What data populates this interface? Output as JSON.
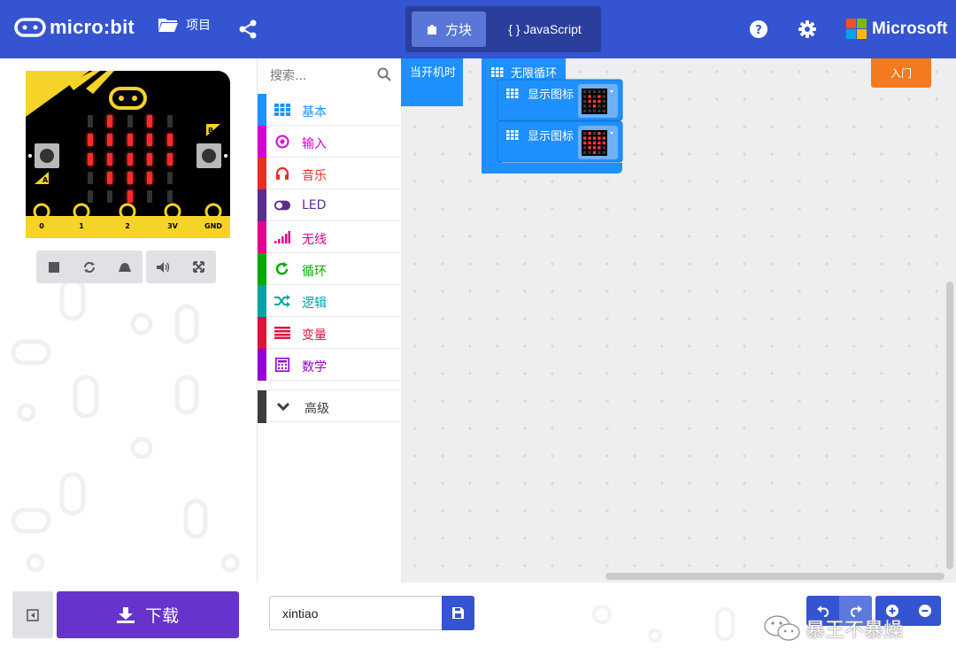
{
  "header": {
    "logo_text": "micro:bit",
    "projects_label": "项目",
    "share_icon": "share-icon",
    "mode_blocks_label": "方块",
    "mode_js_label": "{ } JavaScript",
    "help_icon": "help-icon",
    "settings_icon": "gear-icon",
    "brand_text": "Microsoft"
  },
  "simulator": {
    "led_matrix_on": [
      [
        0,
        1,
        0,
        1,
        0
      ],
      [
        1,
        1,
        1,
        1,
        1
      ],
      [
        1,
        1,
        1,
        1,
        1
      ],
      [
        0,
        1,
        1,
        1,
        0
      ],
      [
        0,
        0,
        1,
        0,
        0
      ]
    ],
    "pins": [
      "0",
      "1",
      "2",
      "3V",
      "GND"
    ],
    "button_a": "A",
    "button_b": "B",
    "controls": [
      "stop-icon",
      "restart-icon",
      "slow-mo-icon",
      "mute-icon",
      "fullscreen-icon"
    ]
  },
  "toolbox": {
    "search_placeholder": "搜索...",
    "categories": [
      {
        "label": "基本",
        "color": "#1e90ff",
        "icon": "grid-icon"
      },
      {
        "label": "输入",
        "color": "#d400d4",
        "icon": "target-icon"
      },
      {
        "label": "音乐",
        "color": "#e63022",
        "icon": "headphones-icon"
      },
      {
        "label": "LED",
        "color": "#5c2d91",
        "icon": "toggle-icon"
      },
      {
        "label": "无线",
        "color": "#e3008c",
        "icon": "signal-icon"
      },
      {
        "label": "循环",
        "color": "#00aa00",
        "icon": "loop-icon"
      },
      {
        "label": "逻辑",
        "color": "#00a4a6",
        "icon": "shuffle-icon"
      },
      {
        "label": "变量",
        "color": "#dc143c",
        "icon": "lines-icon"
      },
      {
        "label": "数学",
        "color": "#9400d3",
        "icon": "calculator-icon"
      }
    ],
    "advanced_label": "高级"
  },
  "workspace": {
    "beginner_label": "入门",
    "on_start_label": "当开机时",
    "forever_label": "无限循环",
    "show_icon_1": "显示图标",
    "show_icon_2": "显示图标",
    "icon1_leds": [
      [
        0,
        0,
        0,
        0,
        0
      ],
      [
        0,
        1,
        0,
        1,
        0
      ],
      [
        0,
        1,
        1,
        1,
        0
      ],
      [
        0,
        0,
        1,
        0,
        0
      ],
      [
        0,
        0,
        0,
        0,
        0
      ]
    ],
    "icon2_leds": [
      [
        0,
        1,
        0,
        1,
        0
      ],
      [
        1,
        1,
        1,
        1,
        1
      ],
      [
        1,
        1,
        1,
        1,
        1
      ],
      [
        0,
        1,
        1,
        1,
        0
      ],
      [
        0,
        0,
        1,
        0,
        0
      ]
    ]
  },
  "footer": {
    "download_label": "下载",
    "project_name": "xintiao",
    "watermark": "暴王不暴燥"
  },
  "colors": {
    "header_bg": "#3454D1",
    "download_bg": "#6633cc",
    "block_basic": "#1e90ff",
    "beginner_btn": "#f47a1f"
  }
}
